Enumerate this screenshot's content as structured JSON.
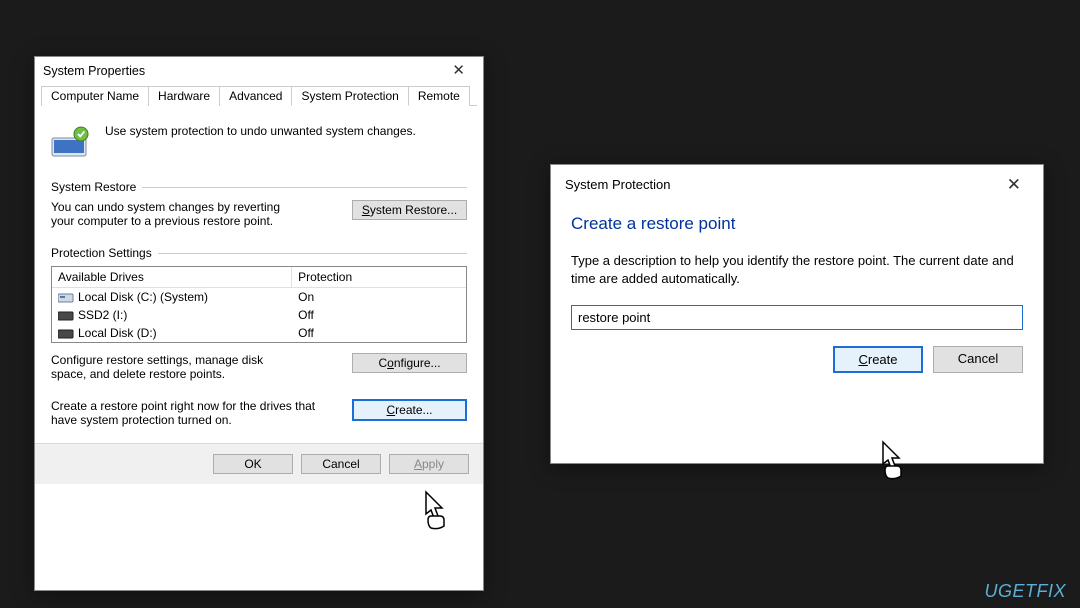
{
  "dialog1": {
    "title": "System Properties",
    "tabs": [
      "Computer Name",
      "Hardware",
      "Advanced",
      "System Protection",
      "Remote"
    ],
    "active_tab": "System Protection",
    "intro": "Use system protection to undo unwanted system changes.",
    "group_restore": {
      "caption": "System Restore",
      "text": "You can undo system changes by reverting your computer to a previous restore point.",
      "button": "System Restore..."
    },
    "group_settings": {
      "caption": "Protection Settings",
      "col_drive": "Available Drives",
      "col_prot": "Protection",
      "drives": [
        {
          "label": "Local Disk (C:) (System)",
          "prot": "On"
        },
        {
          "label": "SSD2 (I:)",
          "prot": "Off"
        },
        {
          "label": "Local Disk (D:)",
          "prot": "Off"
        }
      ],
      "configure_text": "Configure restore settings, manage disk space, and delete restore points.",
      "configure_btn": "Configure...",
      "create_text": "Create a restore point right now for the drives that have system protection turned on.",
      "create_btn": "Create..."
    },
    "footer": {
      "ok": "OK",
      "cancel": "Cancel",
      "apply": "Apply"
    }
  },
  "dialog2": {
    "title": "System Protection",
    "heading": "Create a restore point",
    "desc": "Type a description to help you identify the restore point. The current date and time are added automatically.",
    "input_value": "restore point",
    "create": "Create",
    "cancel": "Cancel"
  },
  "watermark": "UGETFIX"
}
